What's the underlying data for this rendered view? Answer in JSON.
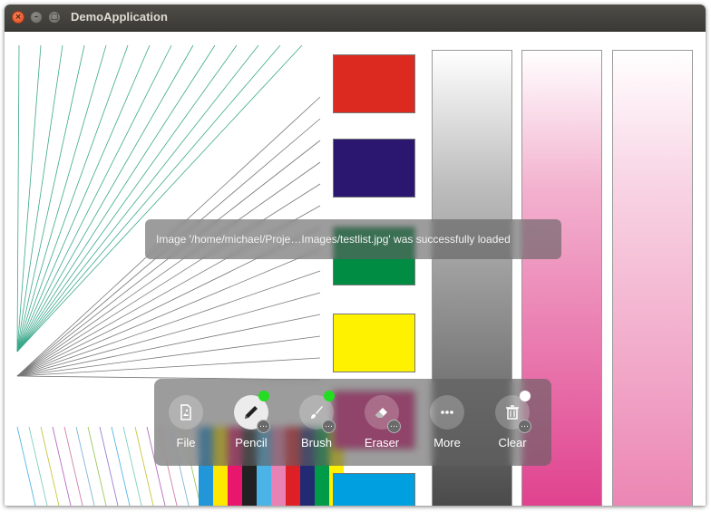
{
  "window": {
    "title": "DemoApplication",
    "buttons": {
      "close_glyph": "×",
      "minimize_glyph": "–",
      "maximize_glyph": "□"
    }
  },
  "image": {
    "swatch_colors": [
      "#dc2a20",
      "#2b1770",
      "#008c42",
      "#fff200",
      "#e0187a",
      "#00a0e0"
    ],
    "stripe_colors": [
      "#2196d8",
      "#ffe800",
      "#e8176d",
      "#212121",
      "#4bb3e6",
      "#e882b4",
      "#de1f26",
      "#232a74",
      "#009b48",
      "#fff100"
    ],
    "gradient_bars": [
      "gray",
      "magenta",
      "pink"
    ]
  },
  "toast": {
    "message": "Image '/home/michael/Proje…Images/testlist.jpg' was successfully loaded"
  },
  "toolbar": {
    "file_label": "File",
    "pencil_label": "Pencil",
    "brush_label": "Brush",
    "eraser_label": "Eraser",
    "more_label": "More",
    "clear_label": "Clear",
    "more_badge": "…",
    "active_tool": "Pencil",
    "indicator_color": "#22dd22"
  }
}
